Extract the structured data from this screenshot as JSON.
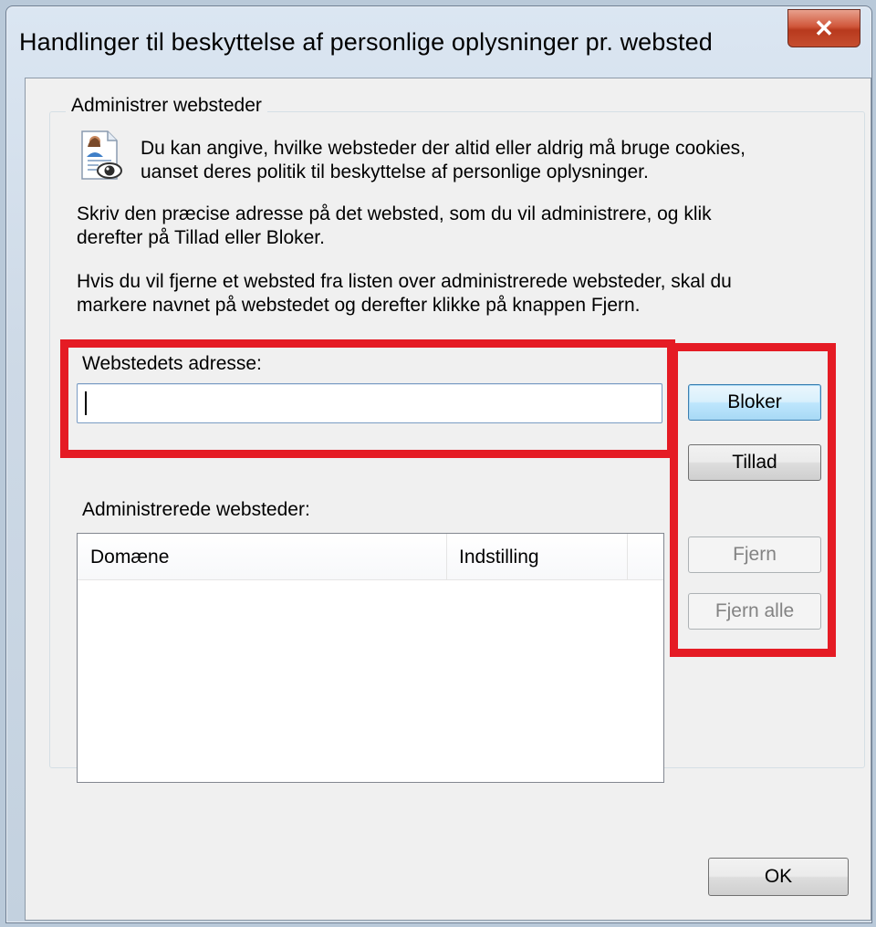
{
  "window": {
    "title": "Handlinger til beskyttelse af personlige oplysninger pr. websted",
    "close_label": "✕"
  },
  "group": {
    "legend": "Administrer websteder"
  },
  "info": {
    "line1": "Du kan angive, hvilke websteder der altid eller aldrig må bruge cookies,",
    "line2": "uanset deres politik til beskyttelse af personlige oplysninger.",
    "para2_line1": "Skriv den præcise adresse på det websted, som du vil administrere, og klik",
    "para2_line2": "derefter på Tillad eller Bloker.",
    "para3_line1": "Hvis du vil fjerne et websted fra listen over administrerede websteder, skal du",
    "para3_line2": "markere navnet på webstedet og derefter klikke på knappen Fjern."
  },
  "address": {
    "label": "Webstedets adresse:",
    "value": ""
  },
  "buttons": {
    "block": "Bloker",
    "allow": "Tillad",
    "remove": "Fjern",
    "remove_all": "Fjern alle",
    "ok": "OK"
  },
  "managed": {
    "label": "Administrerede websteder:",
    "columns": [
      "Domæne",
      "Indstilling"
    ],
    "rows": []
  },
  "colors": {
    "highlight": "#e51b24",
    "default_button_border": "#3c7fb1"
  },
  "icons": [
    "privacy-user-eye-icon",
    "close-icon"
  ]
}
